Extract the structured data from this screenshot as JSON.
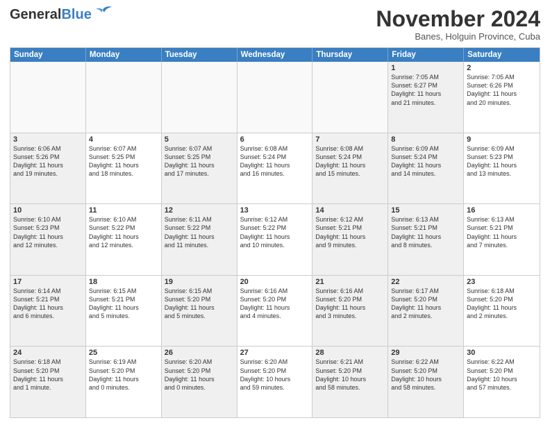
{
  "logo": {
    "line1": "General",
    "line2": "Blue"
  },
  "title": "November 2024",
  "subtitle": "Banes, Holguin Province, Cuba",
  "headers": [
    "Sunday",
    "Monday",
    "Tuesday",
    "Wednesday",
    "Thursday",
    "Friday",
    "Saturday"
  ],
  "rows": [
    [
      {
        "day": "",
        "info": "",
        "empty": true
      },
      {
        "day": "",
        "info": "",
        "empty": true
      },
      {
        "day": "",
        "info": "",
        "empty": true
      },
      {
        "day": "",
        "info": "",
        "empty": true
      },
      {
        "day": "",
        "info": "",
        "empty": true
      },
      {
        "day": "1",
        "info": "Sunrise: 7:05 AM\nSunset: 6:27 PM\nDaylight: 11 hours\nand 21 minutes.",
        "shaded": true
      },
      {
        "day": "2",
        "info": "Sunrise: 7:05 AM\nSunset: 6:26 PM\nDaylight: 11 hours\nand 20 minutes.",
        "shaded": false
      }
    ],
    [
      {
        "day": "3",
        "info": "Sunrise: 6:06 AM\nSunset: 5:26 PM\nDaylight: 11 hours\nand 19 minutes.",
        "shaded": true
      },
      {
        "day": "4",
        "info": "Sunrise: 6:07 AM\nSunset: 5:25 PM\nDaylight: 11 hours\nand 18 minutes.",
        "shaded": false
      },
      {
        "day": "5",
        "info": "Sunrise: 6:07 AM\nSunset: 5:25 PM\nDaylight: 11 hours\nand 17 minutes.",
        "shaded": true
      },
      {
        "day": "6",
        "info": "Sunrise: 6:08 AM\nSunset: 5:24 PM\nDaylight: 11 hours\nand 16 minutes.",
        "shaded": false
      },
      {
        "day": "7",
        "info": "Sunrise: 6:08 AM\nSunset: 5:24 PM\nDaylight: 11 hours\nand 15 minutes.",
        "shaded": true
      },
      {
        "day": "8",
        "info": "Sunrise: 6:09 AM\nSunset: 5:24 PM\nDaylight: 11 hours\nand 14 minutes.",
        "shaded": true
      },
      {
        "day": "9",
        "info": "Sunrise: 6:09 AM\nSunset: 5:23 PM\nDaylight: 11 hours\nand 13 minutes.",
        "shaded": false
      }
    ],
    [
      {
        "day": "10",
        "info": "Sunrise: 6:10 AM\nSunset: 5:23 PM\nDaylight: 11 hours\nand 12 minutes.",
        "shaded": true
      },
      {
        "day": "11",
        "info": "Sunrise: 6:10 AM\nSunset: 5:22 PM\nDaylight: 11 hours\nand 12 minutes.",
        "shaded": false
      },
      {
        "day": "12",
        "info": "Sunrise: 6:11 AM\nSunset: 5:22 PM\nDaylight: 11 hours\nand 11 minutes.",
        "shaded": true
      },
      {
        "day": "13",
        "info": "Sunrise: 6:12 AM\nSunset: 5:22 PM\nDaylight: 11 hours\nand 10 minutes.",
        "shaded": false
      },
      {
        "day": "14",
        "info": "Sunrise: 6:12 AM\nSunset: 5:21 PM\nDaylight: 11 hours\nand 9 minutes.",
        "shaded": true
      },
      {
        "day": "15",
        "info": "Sunrise: 6:13 AM\nSunset: 5:21 PM\nDaylight: 11 hours\nand 8 minutes.",
        "shaded": true
      },
      {
        "day": "16",
        "info": "Sunrise: 6:13 AM\nSunset: 5:21 PM\nDaylight: 11 hours\nand 7 minutes.",
        "shaded": false
      }
    ],
    [
      {
        "day": "17",
        "info": "Sunrise: 6:14 AM\nSunset: 5:21 PM\nDaylight: 11 hours\nand 6 minutes.",
        "shaded": true
      },
      {
        "day": "18",
        "info": "Sunrise: 6:15 AM\nSunset: 5:21 PM\nDaylight: 11 hours\nand 5 minutes.",
        "shaded": false
      },
      {
        "day": "19",
        "info": "Sunrise: 6:15 AM\nSunset: 5:20 PM\nDaylight: 11 hours\nand 5 minutes.",
        "shaded": true
      },
      {
        "day": "20",
        "info": "Sunrise: 6:16 AM\nSunset: 5:20 PM\nDaylight: 11 hours\nand 4 minutes.",
        "shaded": false
      },
      {
        "day": "21",
        "info": "Sunrise: 6:16 AM\nSunset: 5:20 PM\nDaylight: 11 hours\nand 3 minutes.",
        "shaded": true
      },
      {
        "day": "22",
        "info": "Sunrise: 6:17 AM\nSunset: 5:20 PM\nDaylight: 11 hours\nand 2 minutes.",
        "shaded": true
      },
      {
        "day": "23",
        "info": "Sunrise: 6:18 AM\nSunset: 5:20 PM\nDaylight: 11 hours\nand 2 minutes.",
        "shaded": false
      }
    ],
    [
      {
        "day": "24",
        "info": "Sunrise: 6:18 AM\nSunset: 5:20 PM\nDaylight: 11 hours\nand 1 minute.",
        "shaded": true
      },
      {
        "day": "25",
        "info": "Sunrise: 6:19 AM\nSunset: 5:20 PM\nDaylight: 11 hours\nand 0 minutes.",
        "shaded": false
      },
      {
        "day": "26",
        "info": "Sunrise: 6:20 AM\nSunset: 5:20 PM\nDaylight: 11 hours\nand 0 minutes.",
        "shaded": true
      },
      {
        "day": "27",
        "info": "Sunrise: 6:20 AM\nSunset: 5:20 PM\nDaylight: 10 hours\nand 59 minutes.",
        "shaded": false
      },
      {
        "day": "28",
        "info": "Sunrise: 6:21 AM\nSunset: 5:20 PM\nDaylight: 10 hours\nand 58 minutes.",
        "shaded": true
      },
      {
        "day": "29",
        "info": "Sunrise: 6:22 AM\nSunset: 5:20 PM\nDaylight: 10 hours\nand 58 minutes.",
        "shaded": true
      },
      {
        "day": "30",
        "info": "Sunrise: 6:22 AM\nSunset: 5:20 PM\nDaylight: 10 hours\nand 57 minutes.",
        "shaded": false
      }
    ]
  ]
}
